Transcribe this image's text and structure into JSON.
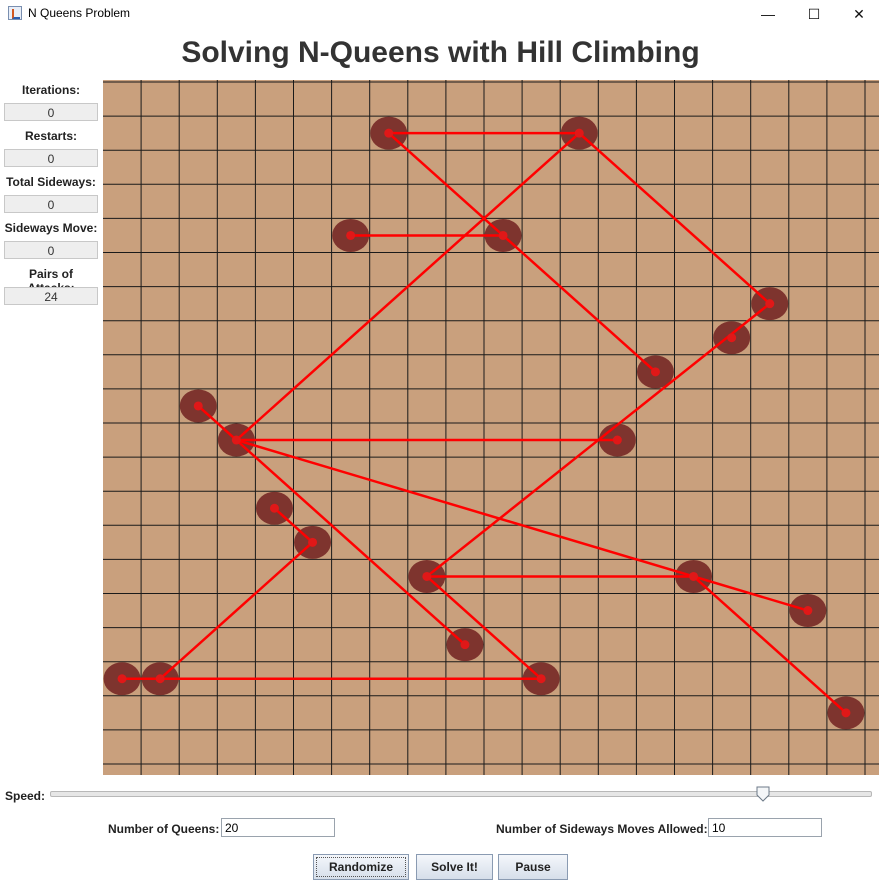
{
  "window": {
    "title": "N Queens Problem",
    "min": "—",
    "max": "☐",
    "close": "✕"
  },
  "heading": "Solving N-Queens with Hill Climbing",
  "stats": [
    {
      "label": "Iterations:",
      "value": "0"
    },
    {
      "label": "Restarts:",
      "value": "0"
    },
    {
      "label": "Total Sideways:",
      "value": "0"
    },
    {
      "label": "Sideways Move:",
      "value": "0"
    },
    {
      "label": "Pairs of Attacks:",
      "value": "24"
    }
  ],
  "board": {
    "n": 20,
    "queen_cols_by_row": [
      19,
      19,
      7,
      12,
      6,
      10,
      17,
      16,
      14,
      2,
      3,
      13,
      4,
      5,
      8,
      15,
      18,
      9,
      0,
      1
    ],
    "queens": [
      {
        "col": 7,
        "row": 1
      },
      {
        "col": 12,
        "row": 1
      },
      {
        "col": 6,
        "row": 4
      },
      {
        "col": 10,
        "row": 4
      },
      {
        "col": 17,
        "row": 6
      },
      {
        "col": 16,
        "row": 7
      },
      {
        "col": 14,
        "row": 8
      },
      {
        "col": 2,
        "row": 9
      },
      {
        "col": 3,
        "row": 10
      },
      {
        "col": 13,
        "row": 10
      },
      {
        "col": 4,
        "row": 12
      },
      {
        "col": 5,
        "row": 13
      },
      {
        "col": 8,
        "row": 14
      },
      {
        "col": 15,
        "row": 14
      },
      {
        "col": 18,
        "row": 15
      },
      {
        "col": 9,
        "row": 16
      },
      {
        "col": 0,
        "row": 17
      },
      {
        "col": 1,
        "row": 17
      },
      {
        "col": 11,
        "row": 17
      },
      {
        "col": 19,
        "row": 18
      }
    ],
    "attacks": [
      [
        [
          7,
          1
        ],
        [
          12,
          1
        ]
      ],
      [
        [
          6,
          4
        ],
        [
          10,
          4
        ]
      ],
      [
        [
          3,
          10
        ],
        [
          13,
          10
        ]
      ],
      [
        [
          8,
          14
        ],
        [
          15,
          14
        ]
      ],
      [
        [
          0,
          17
        ],
        [
          11,
          17
        ]
      ],
      [
        [
          7,
          1
        ],
        [
          14,
          8
        ]
      ],
      [
        [
          12,
          1
        ],
        [
          17,
          6
        ]
      ],
      [
        [
          12,
          1
        ],
        [
          3,
          10
        ]
      ],
      [
        [
          17,
          6
        ],
        [
          8,
          14
        ]
      ],
      [
        [
          2,
          9
        ],
        [
          9,
          16
        ]
      ],
      [
        [
          3,
          10
        ],
        [
          18,
          15
        ]
      ],
      [
        [
          4,
          12
        ],
        [
          5,
          13
        ]
      ],
      [
        [
          5,
          13
        ],
        [
          1,
          17
        ]
      ],
      [
        [
          8,
          14
        ],
        [
          11,
          17
        ]
      ],
      [
        [
          15,
          14
        ],
        [
          19,
          18
        ]
      ]
    ],
    "colors": {
      "board": "#c9a07d",
      "grid": "#1a1a1a",
      "queen": "#7a2e2a",
      "attack": "#ff0000",
      "attack_dot": "#e01818"
    }
  },
  "speed": {
    "label": "Speed:",
    "value_fraction": 0.87
  },
  "queens_field": {
    "label": "Number of Queens:",
    "value": "20"
  },
  "sideways_field": {
    "label": "Number of Sideways Moves Allowed:",
    "value": "10"
  },
  "buttons": {
    "randomize": "Randomize",
    "solve": "Solve It!",
    "pause": "Pause"
  }
}
